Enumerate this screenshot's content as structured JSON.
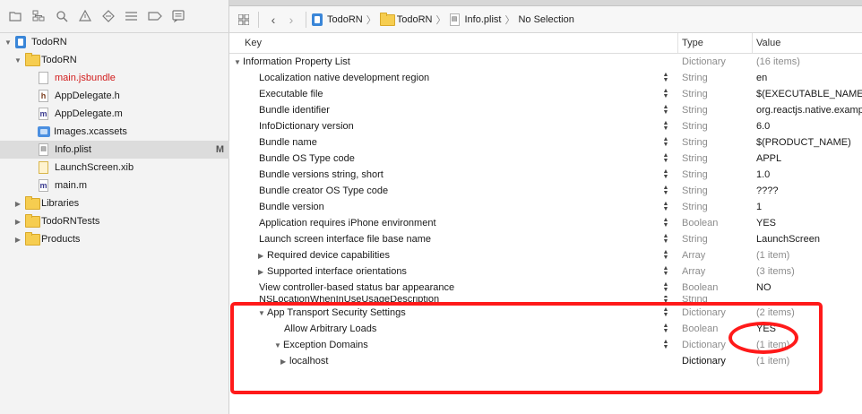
{
  "navigator": {
    "toolbar_icons": [
      "folder-icon",
      "hierarchy-icon",
      "search-icon",
      "warning-icon",
      "test-icon",
      "debug-icon",
      "breakpoint-icon",
      "report-icon"
    ],
    "items": [
      {
        "label": "TodoRN",
        "kind": "project",
        "indent": 0,
        "expanded": true
      },
      {
        "label": "TodoRN",
        "kind": "folder",
        "indent": 1,
        "expanded": true
      },
      {
        "label": "main.jsbundle",
        "kind": "doc-red",
        "indent": 2
      },
      {
        "label": "AppDelegate.h",
        "kind": "h",
        "indent": 2
      },
      {
        "label": "AppDelegate.m",
        "kind": "m",
        "indent": 2
      },
      {
        "label": "Images.xcassets",
        "kind": "xcassets",
        "indent": 2
      },
      {
        "label": "Info.plist",
        "kind": "plist",
        "indent": 2,
        "selected": true,
        "badge": "M"
      },
      {
        "label": "LaunchScreen.xib",
        "kind": "xib",
        "indent": 2
      },
      {
        "label": "main.m",
        "kind": "m",
        "indent": 2
      },
      {
        "label": "Libraries",
        "kind": "folder",
        "indent": 1,
        "expanded": false
      },
      {
        "label": "TodoRNTests",
        "kind": "folder",
        "indent": 1,
        "expanded": false
      },
      {
        "label": "Products",
        "kind": "folder",
        "indent": 1,
        "expanded": false
      }
    ]
  },
  "jumpbar": {
    "crumbs": [
      "TodoRN",
      "TodoRN",
      "Info.plist",
      "No Selection"
    ]
  },
  "plist": {
    "headers": {
      "key": "Key",
      "type": "Type",
      "value": "Value"
    },
    "rows": [
      {
        "key": "Information Property List",
        "type": "Dictionary",
        "value": "(16 items)",
        "level": 0,
        "tri": "open",
        "muted": true
      },
      {
        "key": "Localization native development region",
        "type": "String",
        "value": "en",
        "level": 1,
        "stepper": true
      },
      {
        "key": "Executable file",
        "type": "String",
        "value": "$(EXECUTABLE_NAME)",
        "level": 1,
        "stepper": true
      },
      {
        "key": "Bundle identifier",
        "type": "String",
        "value": "org.reactjs.native.example",
        "level": 1,
        "stepper": true
      },
      {
        "key": "InfoDictionary version",
        "type": "String",
        "value": "6.0",
        "level": 1,
        "stepper": true
      },
      {
        "key": "Bundle name",
        "type": "String",
        "value": "$(PRODUCT_NAME)",
        "level": 1,
        "stepper": true
      },
      {
        "key": "Bundle OS Type code",
        "type": "String",
        "value": "APPL",
        "level": 1,
        "stepper": true
      },
      {
        "key": "Bundle versions string, short",
        "type": "String",
        "value": "1.0",
        "level": 1,
        "stepper": true
      },
      {
        "key": "Bundle creator OS Type code",
        "type": "String",
        "value": "????",
        "level": 1,
        "stepper": true
      },
      {
        "key": "Bundle version",
        "type": "String",
        "value": "1",
        "level": 1,
        "stepper": true
      },
      {
        "key": "Application requires iPhone environment",
        "type": "Boolean",
        "value": "YES",
        "level": 1,
        "stepper": true
      },
      {
        "key": "Launch screen interface file base name",
        "type": "String",
        "value": "LaunchScreen",
        "level": 1,
        "stepper": true
      },
      {
        "key": "Required device capabilities",
        "type": "Array",
        "value": "(1 item)",
        "level": 1,
        "tri": "closed",
        "stepper": true,
        "muted": true
      },
      {
        "key": "Supported interface orientations",
        "type": "Array",
        "value": "(3 items)",
        "level": 1,
        "tri": "closed",
        "stepper": true,
        "muted": true
      },
      {
        "key": "View controller-based status bar appearance",
        "type": "Boolean",
        "value": "NO",
        "level": 1,
        "stepper": true
      },
      {
        "key": "NSLocationWhenInUseUsageDescription",
        "type": "String",
        "value": "",
        "level": 1,
        "stepper": true,
        "clipped": true
      },
      {
        "key": "App Transport Security Settings",
        "type": "Dictionary",
        "value": "(2 items)",
        "level": 1,
        "tri": "open",
        "stepper": true,
        "muted": true
      },
      {
        "key": "Allow Arbitrary Loads",
        "type": "Boolean",
        "value": "YES",
        "level": 2,
        "stepper": true
      },
      {
        "key": "Exception Domains",
        "type": "Dictionary",
        "value": "(1 item)",
        "level": 2,
        "tri": "open",
        "stepper": true,
        "muted": true
      },
      {
        "key": "localhost",
        "type": "Dictionary",
        "value": "(1 item)",
        "level": 3,
        "tri": "closed",
        "muted": true,
        "type_dark": true
      }
    ]
  },
  "colors": {
    "annotation": "#ff1a1a",
    "selection": "#dcdcdc",
    "accent": "#3a86d8"
  }
}
